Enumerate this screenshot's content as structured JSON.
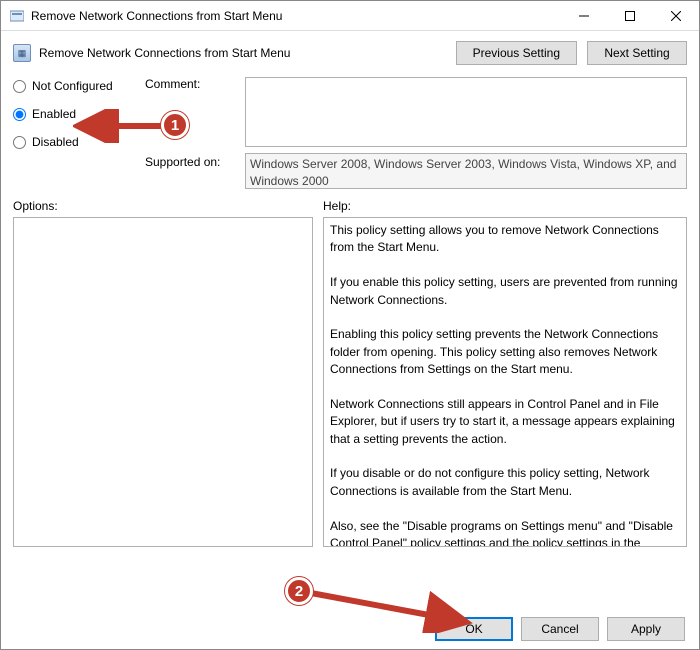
{
  "titlebar": {
    "title": "Remove Network Connections from Start Menu"
  },
  "header": {
    "icon_title": "Remove Network Connections from Start Menu",
    "previous": "Previous Setting",
    "next": "Next Setting"
  },
  "config": {
    "radio_not_configured": "Not Configured",
    "radio_enabled": "Enabled",
    "radio_disabled": "Disabled",
    "selected": "enabled",
    "comment_label": "Comment:",
    "comment_value": "",
    "supported_label": "Supported on:",
    "supported_value": "Windows Server 2008, Windows Server 2003, Windows Vista, Windows XP, and Windows 2000"
  },
  "panes": {
    "options_label": "Options:",
    "options_content": "",
    "help_label": "Help:",
    "help_content": "This policy setting allows you to remove Network Connections from the Start Menu.\n\nIf you enable this policy setting, users are prevented from running Network Connections.\n\nEnabling this policy setting prevents the Network Connections folder from opening. This policy setting also removes Network Connections from Settings on the Start menu.\n\nNetwork Connections still appears in Control Panel and in File Explorer, but if users try to start it, a message appears explaining that a setting prevents the action.\n\nIf you disable or do not configure this policy setting, Network Connections is available from the Start Menu.\n\nAlso, see the \"Disable programs on Settings menu\" and \"Disable Control Panel\" policy settings and the policy settings in the Network Connections folder (Computer Configuration and User Configuration\\Administrative Templates\\Network\\Network"
  },
  "footer": {
    "ok": "OK",
    "cancel": "Cancel",
    "apply": "Apply"
  },
  "annotations": {
    "badge1": "1",
    "badge2": "2"
  }
}
